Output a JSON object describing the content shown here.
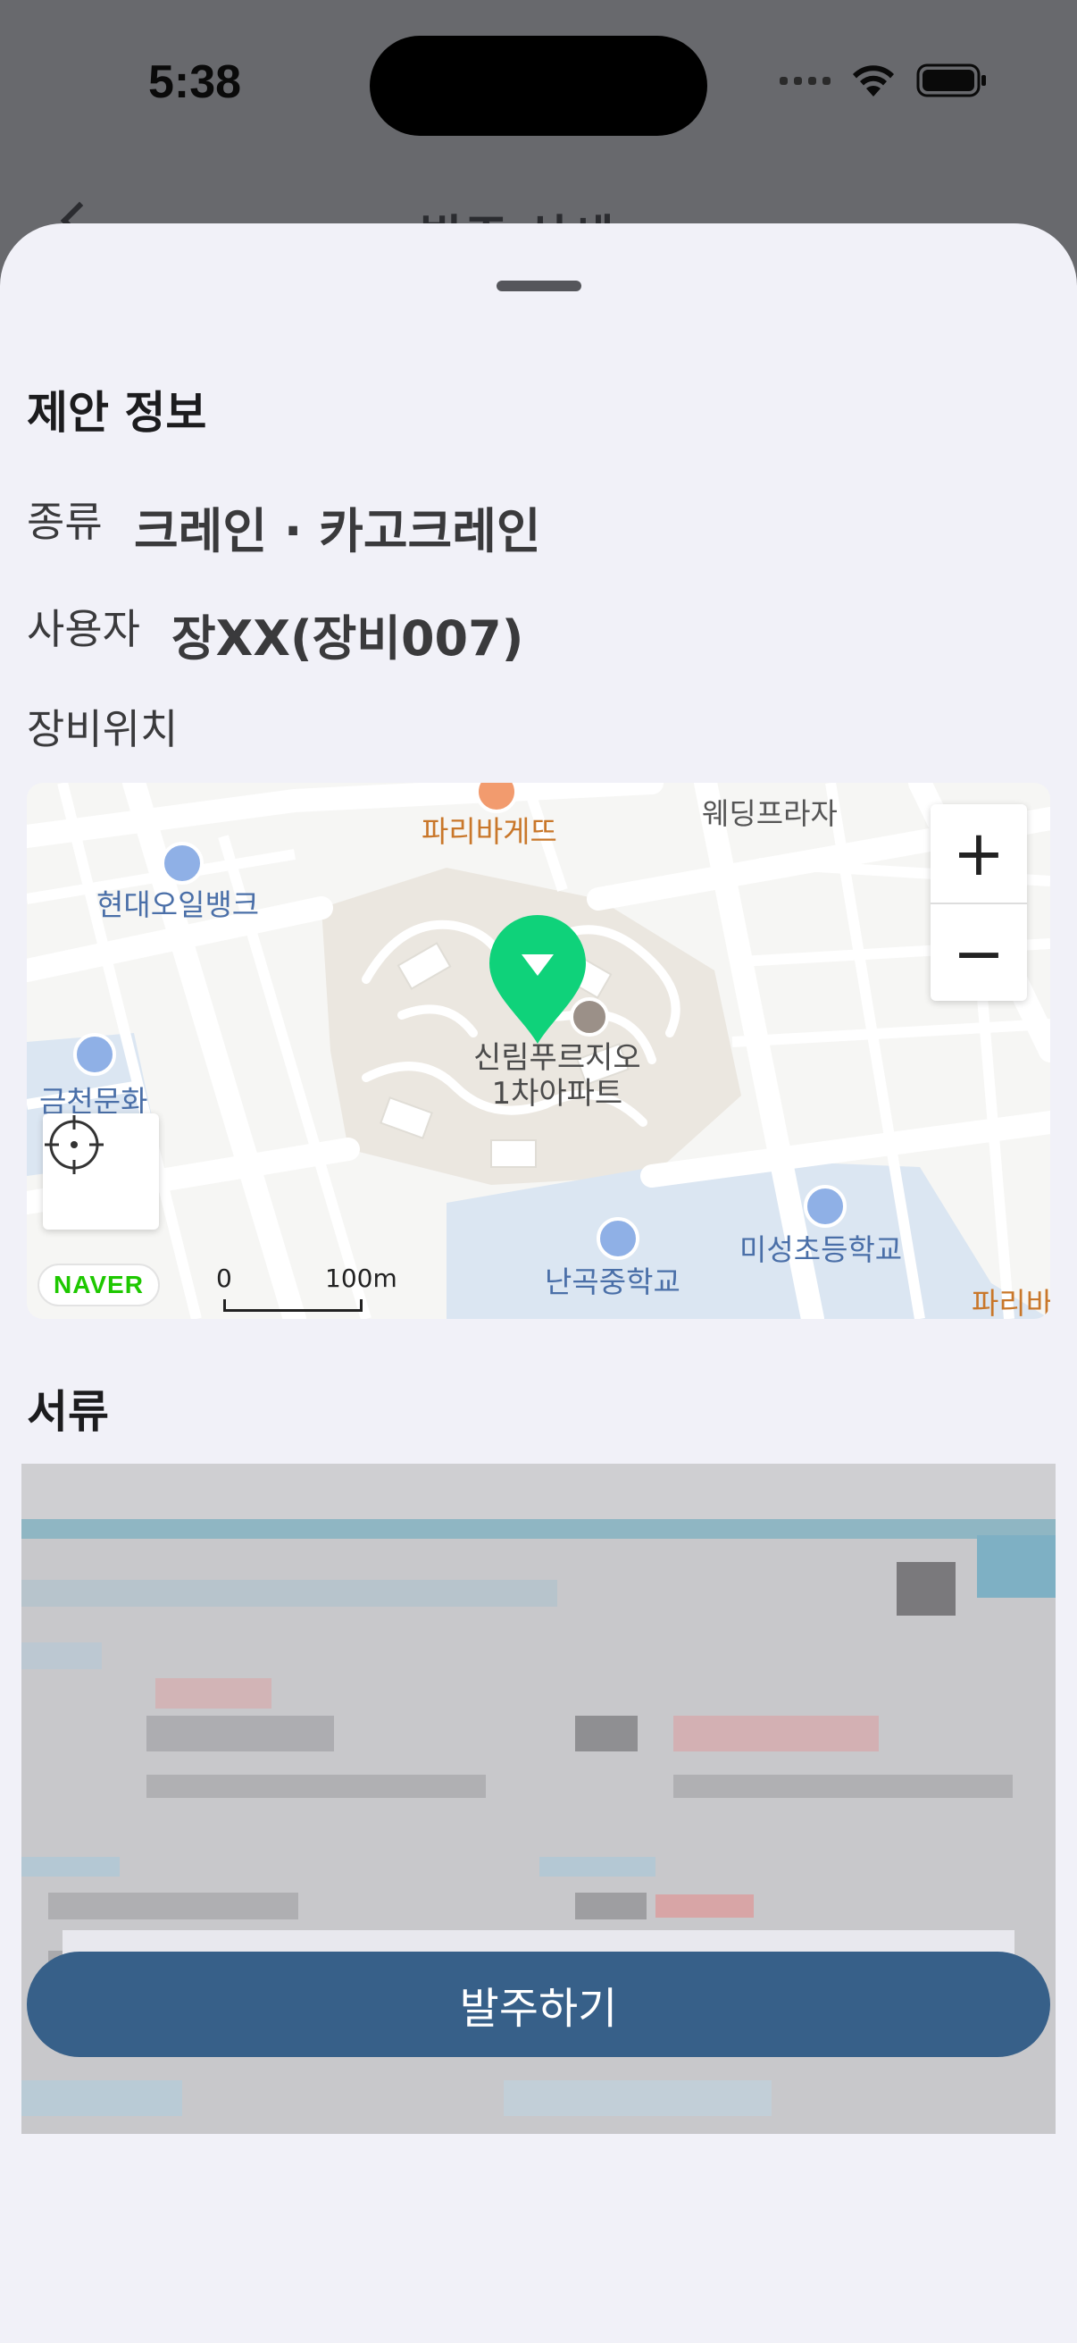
{
  "status_bar": {
    "time": "5:38"
  },
  "backdrop": {
    "title": "발주 상세"
  },
  "sheet": {
    "section_title": "제안 정보",
    "type_label": "종류",
    "type_value": "크레인 · 카고크레인",
    "user_label": "사용자",
    "user_value": "장XX(장비007)",
    "location_label": "장비위치",
    "documents_title": "서류",
    "order_button": "발주하기"
  },
  "map": {
    "labels": {
      "bakery_top": "파리바게뜨",
      "wedding": "웨딩프라자",
      "oil_bank": "현대오일뱅크",
      "geumcheon": "금천문화",
      "apartment": "신림푸르지오\n1차아파트",
      "misung_school": "미성초등학교",
      "nangok_school": "난곡중학교",
      "bakery_right": "파리바"
    },
    "zoom_in": "+",
    "zoom_out": "−",
    "logo": "NAVER",
    "scale_start": "0",
    "scale_end": "100m",
    "marker_color": "#0fd27a",
    "accent_color": "#376089"
  }
}
